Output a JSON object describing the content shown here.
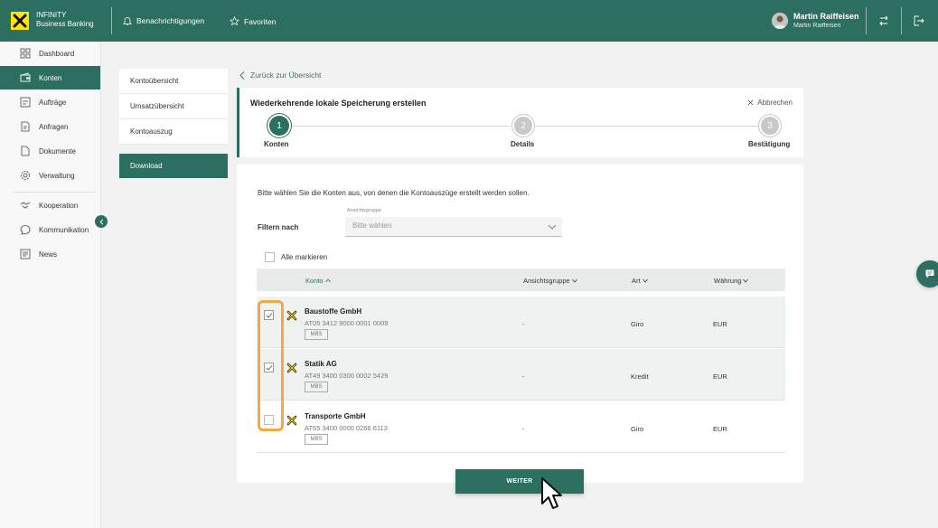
{
  "app": {
    "brand_line1": "INFINITY",
    "brand_line2": "Business Banking",
    "notifications": "Benachrichtigungen",
    "favorites": "Favoriten",
    "user_name": "Martin Raiffeisen",
    "user_company": "Martin Raiffeisen",
    "accent_color": "#2c6e5f",
    "highlight_color": "#f5a742"
  },
  "sidebar": {
    "items": [
      {
        "label": "Dashboard",
        "icon": "dashboard-icon"
      },
      {
        "label": "Konten",
        "icon": "wallet-icon"
      },
      {
        "label": "Aufträge",
        "icon": "transfer-icon"
      },
      {
        "label": "Anfragen",
        "icon": "request-icon"
      },
      {
        "label": "Dokumente",
        "icon": "document-icon"
      },
      {
        "label": "Verwaltung",
        "icon": "settings-icon"
      },
      {
        "label": "Kooperation",
        "icon": "handshake-icon"
      },
      {
        "label": "Kommunikation",
        "icon": "chat-icon"
      },
      {
        "label": "News",
        "icon": "news-icon"
      }
    ],
    "active": "Konten"
  },
  "submenu": {
    "items": [
      "Kontoübersicht",
      "Umsatzübersicht",
      "Kontoauszug"
    ],
    "download": "Download"
  },
  "back_link": "Zurück zur Übersicht",
  "wizard": {
    "title": "Wiederkehrende lokale Speicherung erstellen",
    "cancel": "Abbrechen",
    "steps": [
      {
        "number": "1",
        "label": "Konten",
        "state": "active"
      },
      {
        "number": "2",
        "label": "Details",
        "state": "inactive"
      },
      {
        "number": "3",
        "label": "Bestätigung",
        "state": "inactive"
      }
    ]
  },
  "main": {
    "instruction": "Bitte wählen Sie die Konten aus, von denen die Kontoauszüge erstellt werden sollen.",
    "filter_label": "Filtern nach",
    "select_caption": "Ansichtsgruppe",
    "select_placeholder": "Bitte wählen",
    "select_all": "Alle markieren",
    "columns": [
      "Konto",
      "Ansichtsgruppe",
      "Art",
      "Währung"
    ],
    "rows": [
      {
        "name": "Baustoffe GmbH",
        "iban": "AT05 3412 9000 0001 0009",
        "badge": "MBS",
        "group": "-",
        "type": "Giro",
        "currency": "EUR",
        "checked": true
      },
      {
        "name": "Statik AG",
        "iban": "AT49 3400 0300 0002 5429",
        "badge": "MBS",
        "group": "-",
        "type": "Kredit",
        "currency": "EUR",
        "checked": true
      },
      {
        "name": "Transporte GmbH",
        "iban": "AT65 3400 0000 0266 6113",
        "badge": "MBS",
        "group": "-",
        "type": "Giro",
        "currency": "EUR",
        "checked": false
      }
    ],
    "continue": "WEITER"
  }
}
